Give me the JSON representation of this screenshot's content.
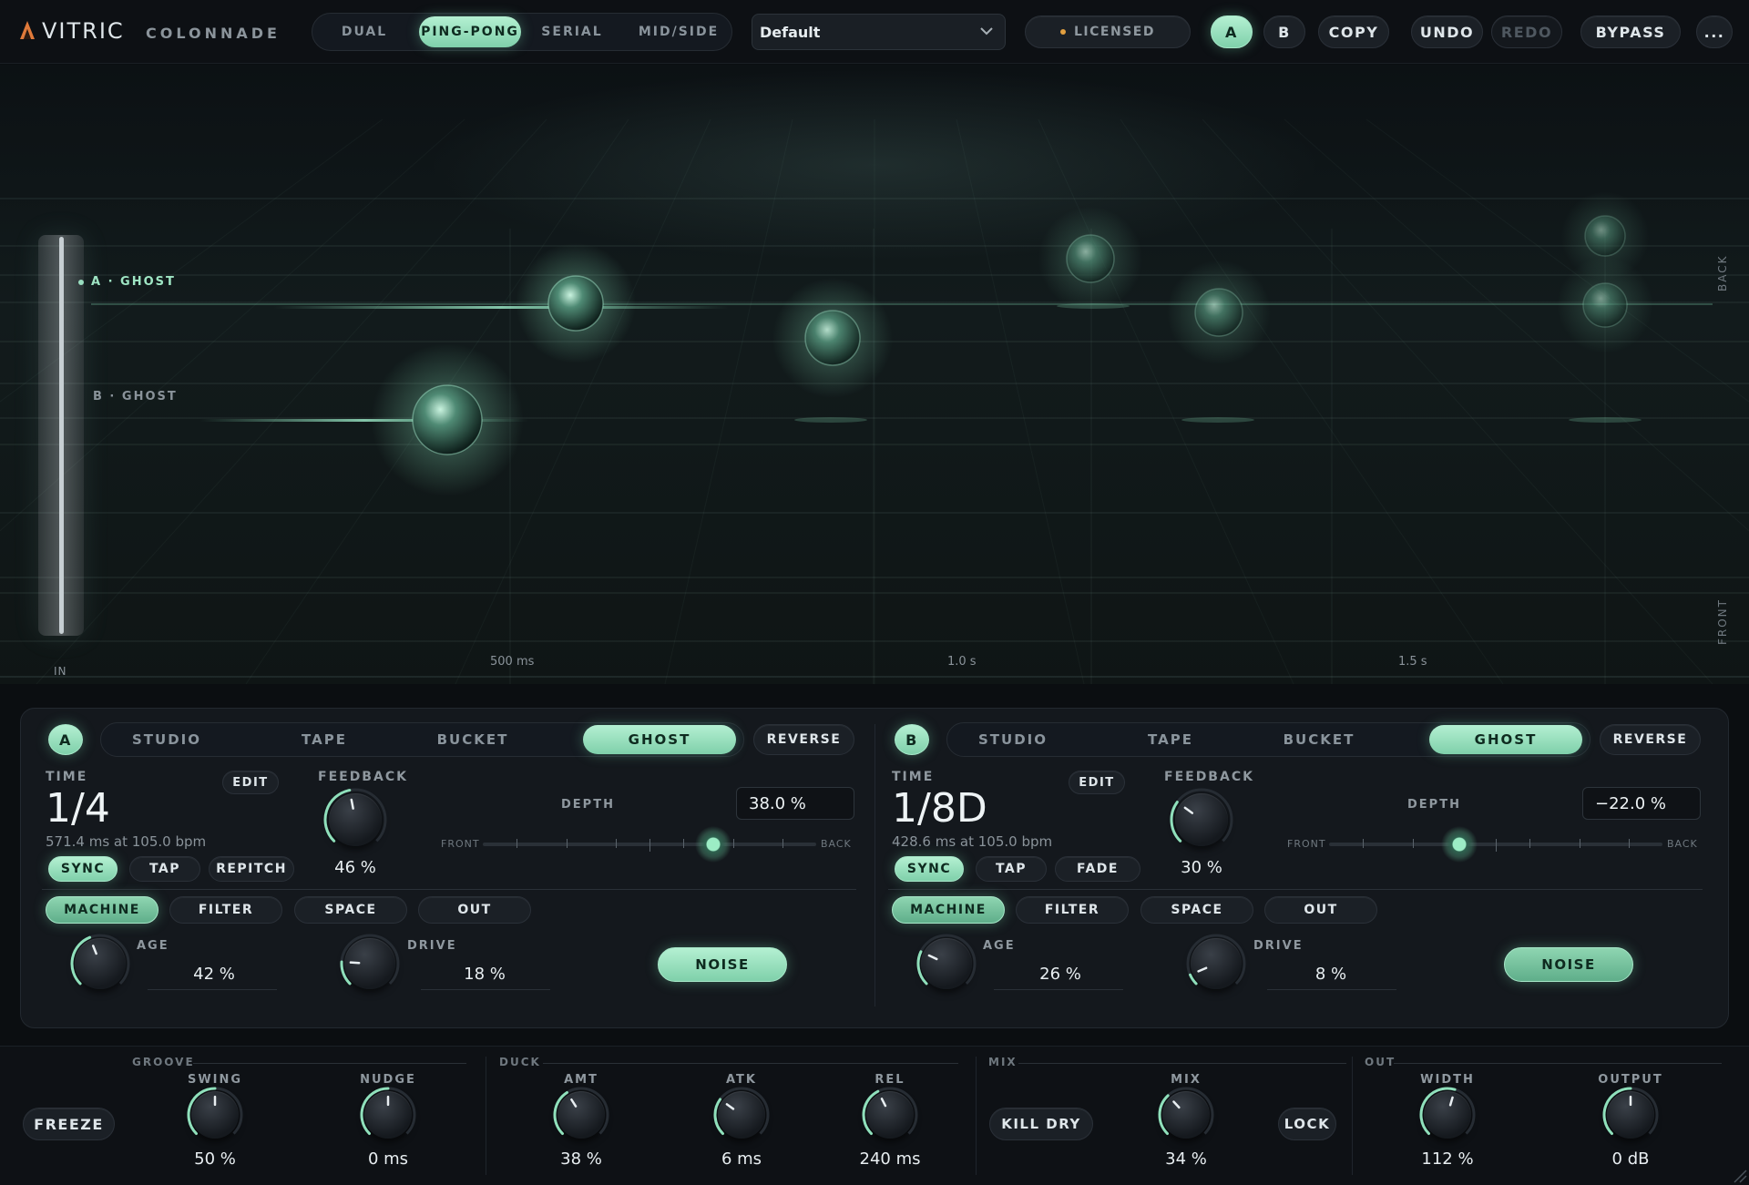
{
  "brand": {
    "logo": "VITRIC",
    "product": "COLONNADE"
  },
  "header": {
    "modes": [
      {
        "label": "DUAL",
        "active": false
      },
      {
        "label": "PING-PONG",
        "active": true
      },
      {
        "label": "SERIAL",
        "active": false
      },
      {
        "label": "MID/SIDE",
        "active": false
      }
    ],
    "preset": "Default",
    "license": "LICENSED",
    "ab": {
      "a": "A",
      "b": "B",
      "active": "A"
    },
    "copy": "COPY",
    "undo": "UNDO",
    "redo": "REDO",
    "bypass": "BYPASS",
    "more": "..."
  },
  "stage": {
    "lane_a": "A · GHOST",
    "lane_b": "B · GHOST",
    "in_label": "IN",
    "in_level": 0.72,
    "back_label": "BACK",
    "front_label": "FRONT",
    "time_labels": [
      "500 ms",
      "1.0 s",
      "1.5 s"
    ]
  },
  "lines": [
    {
      "id": "A",
      "label": "A",
      "styles": [
        "STUDIO",
        "TAPE",
        "BUCKET",
        "GHOST"
      ],
      "style_active": "GHOST",
      "reverse": "REVERSE",
      "time_label": "TIME",
      "time_value": "1/4",
      "time_sub": "571.4 ms at 105.0 bpm",
      "edit": "EDIT",
      "time_buttons": [
        {
          "label": "SYNC",
          "active": true
        },
        {
          "label": "TAP",
          "active": false
        },
        {
          "label": "REPITCH",
          "active": false
        }
      ],
      "feedback_label": "FEEDBACK",
      "feedback_value": "46 %",
      "feedback": 0.46,
      "depth_label": "DEPTH",
      "depth_value": "38.0 %",
      "depth": 0.38,
      "front": "FRONT",
      "back": "BACK",
      "tabs": [
        {
          "label": "MACHINE",
          "active": true
        },
        {
          "label": "FILTER",
          "active": false
        },
        {
          "label": "SPACE",
          "active": false
        },
        {
          "label": "OUT",
          "active": false
        }
      ],
      "age_label": "AGE",
      "age_value": "42 %",
      "age": 0.42,
      "drive_label": "DRIVE",
      "drive_value": "18 %",
      "drive": 0.18,
      "noise": "NOISE"
    },
    {
      "id": "B",
      "label": "B",
      "styles": [
        "STUDIO",
        "TAPE",
        "BUCKET",
        "GHOST"
      ],
      "style_active": "GHOST",
      "reverse": "REVERSE",
      "time_label": "TIME",
      "time_value": "1/8D",
      "time_sub": "428.6 ms at 105.0 bpm",
      "edit": "EDIT",
      "time_buttons": [
        {
          "label": "SYNC",
          "active": true
        },
        {
          "label": "TAP",
          "active": false
        },
        {
          "label": "FADE",
          "active": false
        }
      ],
      "feedback_label": "FEEDBACK",
      "feedback_value": "30 %",
      "feedback": 0.3,
      "depth_label": "DEPTH",
      "depth_value": "−22.0 %",
      "depth": -0.22,
      "front": "FRONT",
      "back": "BACK",
      "tabs": [
        {
          "label": "MACHINE",
          "active": true
        },
        {
          "label": "FILTER",
          "active": false
        },
        {
          "label": "SPACE",
          "active": false
        },
        {
          "label": "OUT",
          "active": false
        }
      ],
      "age_label": "AGE",
      "age_value": "26 %",
      "age": 0.26,
      "drive_label": "DRIVE",
      "drive_value": "8 %",
      "drive": 0.08,
      "noise": "NOISE"
    }
  ],
  "footer": {
    "freeze": "FREEZE",
    "groove": {
      "title": "GROOVE",
      "swing_label": "SWING",
      "swing_value": "50 %",
      "swing": 0.5,
      "nudge_label": "NUDGE",
      "nudge_value": "0 ms",
      "nudge": 0.5
    },
    "duck": {
      "title": "DUCK",
      "amt_label": "AMT",
      "amt_value": "38 %",
      "amt": 0.38,
      "atk_label": "ATK",
      "atk_value": "6 ms",
      "atk": 0.3,
      "rel_label": "REL",
      "rel_value": "240 ms",
      "rel": 0.4
    },
    "mix": {
      "title": "MIX",
      "kill_dry": "KILL DRY",
      "mix_label": "MIX",
      "mix_value": "34 %",
      "mix": 0.34,
      "lock": "LOCK"
    },
    "out": {
      "title": "OUT",
      "width_label": "WIDTH",
      "width_value": "112 %",
      "width": 0.56,
      "output_label": "OUTPUT",
      "output_value": "0 dB",
      "output": 0.5
    }
  },
  "colors": {
    "accent": "#8fe0bb",
    "bg": "#0b0e11",
    "panel": "#14181d"
  }
}
